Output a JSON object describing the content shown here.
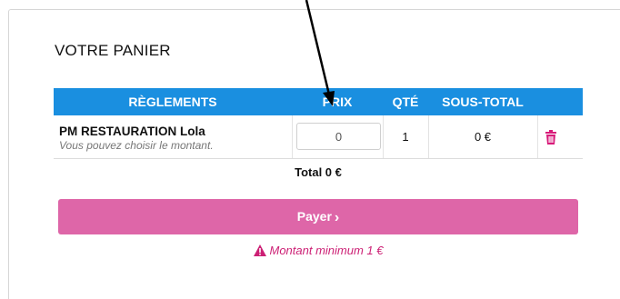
{
  "panier": {
    "title": "VOTRE PANIER",
    "columns": {
      "reglements": "RÈGLEMENTS",
      "prix": "PRIX",
      "qte": "QTÉ",
      "subtotal": "SOUS-TOTAL"
    },
    "items": [
      {
        "name": "PM RESTAURATION Lola",
        "note": "Vous pouvez choisir le montant.",
        "price_value": "0",
        "qty": "1",
        "subtotal": "0 €"
      }
    ],
    "total": "Total 0 €",
    "pay_label": "Payer",
    "warning": "Montant minimum 1 €"
  },
  "icons": {
    "delete": "trash-icon",
    "pay_chevron": "chevron-right-icon",
    "warning": "warning-triangle-icon",
    "annotation": "annotation-arrow"
  },
  "colors": {
    "header_bg": "#1a8fe0",
    "accent_pink": "#de66a8",
    "warning_text": "#cc1f74",
    "trash": "#d81b7a"
  }
}
